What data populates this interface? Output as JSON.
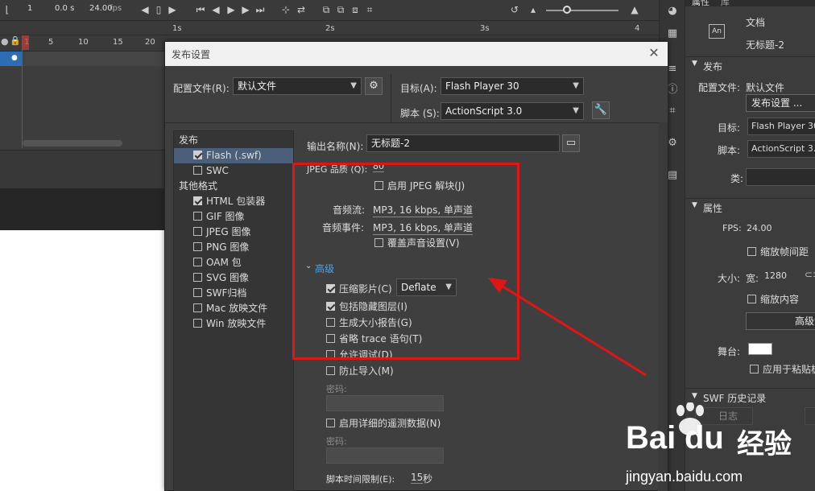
{
  "toolbar": {
    "frame": "1",
    "time": "0.0 s",
    "fps": "24.00",
    "fps_unit": "fps"
  },
  "ruler": {
    "frames": [
      "1",
      "5",
      "10",
      "15",
      "20"
    ],
    "seconds": [
      "1s",
      "2s",
      "3s",
      "4"
    ]
  },
  "dialog": {
    "title": "发布设置",
    "profile_label": "配置文件(R):",
    "profile_value": "默认文件",
    "target_label": "目标(A):",
    "target_value": "Flash Player 30",
    "script_label": "脚本 (S):",
    "script_value": "ActionScript 3.0",
    "output_label": "输出名称(N):",
    "output_value": "无标题-2",
    "jpeg_quality_label": "JPEG 品质 (Q):",
    "jpeg_quality_value": "80",
    "enable_jpeg": "启用 JPEG 解块(J)",
    "audio_stream_label": "音频流:",
    "audio_stream_value": "MP3, 16 kbps, 单声道",
    "audio_event_label": "音频事件:",
    "audio_event_value": "MP3, 16 kbps, 单声道",
    "override_sound": "覆盖声音设置(V)",
    "advanced_label": "高级",
    "compress_movie": "压缩影片(C)",
    "compress_value": "Deflate",
    "include_hidden": "包括隐藏图层(I)",
    "size_report": "生成大小报告(G)",
    "omit_trace": "省略 trace 语句(T)",
    "allow_debug": "允许调试(D)",
    "protect_import": "防止导入(M)",
    "password_label_1": "密码:",
    "detailed_telemetry": "启用详细的遥测数据(N)",
    "password_label_2": "密码:",
    "script_time_limit_label": "脚本时间限制(E):",
    "script_time_limit_value": "15",
    "script_time_limit_unit": "秒"
  },
  "left_list": {
    "publish_header": "发布",
    "flash": "Flash (.swf)",
    "swc": "SWC",
    "other_header": "其他格式",
    "html": "HTML 包装器",
    "gif": "GIF 图像",
    "jpeg": "JPEG 图像",
    "png": "PNG 图像",
    "oam": "OAM 包",
    "svg": "SVG 图像",
    "swf_archive": "SWF归档",
    "mac": "Mac 放映文件",
    "win": "Win 放映文件"
  },
  "props": {
    "tab_props": "属性",
    "tab_lib": "库",
    "doc_icon": "An",
    "doc_label": "文档",
    "doc_name": "无标题-2",
    "publish_section": "发布",
    "profile_label": "配置文件:",
    "profile_value": "默认文件",
    "publish_settings_btn": "发布设置 ...",
    "target_label": "目标:",
    "target_value": "Flash Player 30",
    "script_label": "脚本:",
    "script_value": "ActionScript 3.0",
    "class_label": "类:",
    "props_section": "属性",
    "fps_label": "FPS:",
    "fps_value": "24.00",
    "scale_spans": "缩放帧间距",
    "size_label": "大小:",
    "width_label": "宽:",
    "width_value": "1280",
    "scale_content": "缩放内容",
    "advanced_btn": "高级设",
    "stage_label": "舞台:",
    "apply_paste": "应用于粘贴板",
    "swf_history": "SWF 历史记录",
    "log_btn": "日志"
  },
  "watermark": {
    "text1": "Bai",
    "text2": "du",
    "text3": "经验",
    "url": "jingyan.baidu.com"
  }
}
